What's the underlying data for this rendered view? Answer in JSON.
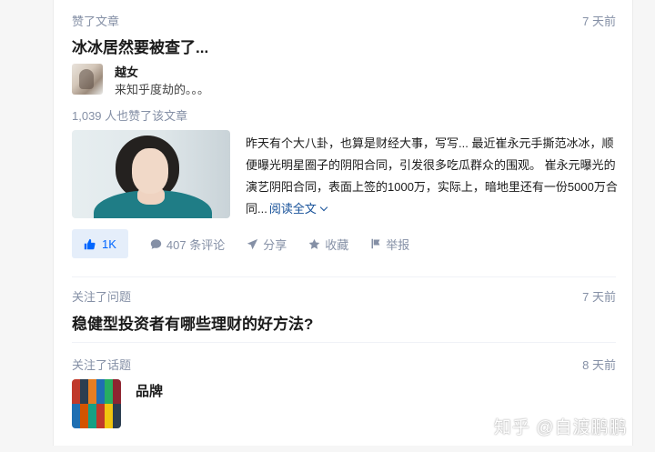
{
  "feed": {
    "item1": {
      "action": "赞了文章",
      "time": "7 天前",
      "title": "冰冰居然要被查了...",
      "author_name": "越女",
      "author_bio": "来知乎度劫的。。。",
      "likes_line": "1,039 人也赞了该文章",
      "excerpt": "昨天有个大八卦，也算是财经大事，写写... 最近崔永元手撕范冰冰，顺便曝光明星圈子的阴阳合同，引发很多吃瓜群众的围观。 崔永元曝光的演艺阴阳合同，表面上签的1000万，实际上，暗地里还有一份5000万合同...",
      "read_more": "阅读全文",
      "vote_count": "1K",
      "comments": "407 条评论",
      "share": "分享",
      "collect": "收藏",
      "report": "举报"
    },
    "item2": {
      "action": "关注了问题",
      "time": "7 天前",
      "title": "稳健型投资者有哪些理财的好方法?"
    },
    "item3": {
      "action": "关注了话题",
      "time": "8 天前",
      "topic": "品牌"
    }
  },
  "watermark": "知乎 @自渡鹏鹏",
  "colors": {
    "accent": "#0066ff",
    "vote_bg": "#e5eefa",
    "meta": "#8590a6",
    "link": "#175199"
  },
  "icons": [
    "thumbs-up-icon",
    "comment-icon",
    "share-icon",
    "star-icon",
    "flag-icon",
    "chevron-down-icon"
  ]
}
